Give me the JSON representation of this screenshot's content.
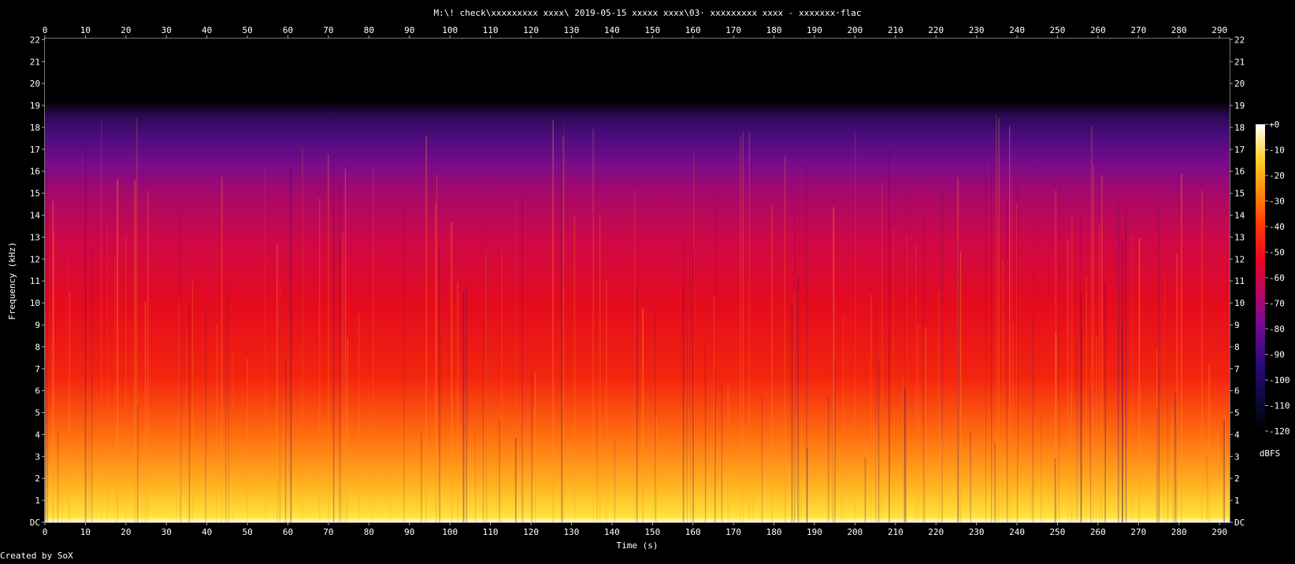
{
  "chart_data": {
    "type": "heatmap",
    "title": "M:\\! check\\xxxxxxxxx xxxx\\ 2019-05-15  xxxxx xxxx\\03· xxxxxxxxx xxxx - xxxxxxx·flac",
    "xlabel": "Time (s)",
    "ylabel": "Frequency (kHz)",
    "x_ticks": [
      "0",
      "10",
      "20",
      "30",
      "40",
      "50",
      "60",
      "70",
      "80",
      "90",
      "100",
      "110",
      "120",
      "130",
      "140",
      "150",
      "160",
      "170",
      "180",
      "190",
      "200",
      "210",
      "220",
      "230",
      "240",
      "250",
      "260",
      "270",
      "280",
      "290"
    ],
    "y_ticks": [
      "DC",
      "1",
      "2",
      "3",
      "4",
      "5",
      "6",
      "7",
      "8",
      "9",
      "10",
      "11",
      "12",
      "13",
      "14",
      "15",
      "16",
      "17",
      "18",
      "19",
      "20",
      "21",
      "22"
    ],
    "xlim": [
      0,
      292.5
    ],
    "ylim": [
      0,
      22.05
    ],
    "colorbar": {
      "label": "dBFS",
      "ticks": [
        "+0",
        "-10",
        "-20",
        "-30",
        "-40",
        "-50",
        "-60",
        "-70",
        "-80",
        "-90",
        "-100",
        "-110",
        "-120"
      ],
      "range": [
        -120,
        0
      ]
    },
    "spectrum_cutoff_khz": 20,
    "footer": "Created by SoX"
  }
}
